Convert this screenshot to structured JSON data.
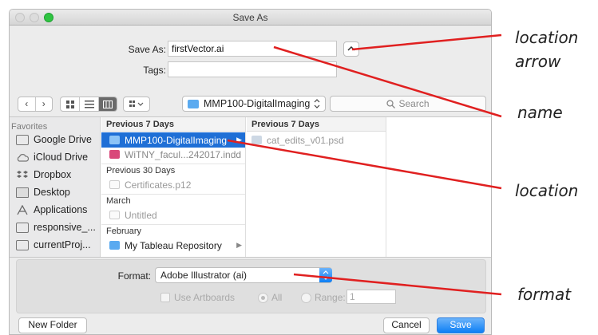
{
  "window": {
    "title": "Save As"
  },
  "form": {
    "save_as_label": "Save As:",
    "save_as_value": "firstVector.ai",
    "tags_label": "Tags:",
    "tags_value": ""
  },
  "toolbar": {
    "location": "MMP100-DigitalImaging",
    "search_placeholder": "Search"
  },
  "sidebar": {
    "heading": "Favorites",
    "items": [
      {
        "label": "Google Drive",
        "icon": "folder-icon"
      },
      {
        "label": "iCloud Drive",
        "icon": "cloud-icon"
      },
      {
        "label": "Dropbox",
        "icon": "dropbox-icon"
      },
      {
        "label": "Desktop",
        "icon": "desktop-icon"
      },
      {
        "label": "Applications",
        "icon": "applications-icon"
      },
      {
        "label": "responsive_...",
        "icon": "folder-icon"
      },
      {
        "label": "currentProj...",
        "icon": "folder-icon"
      }
    ]
  },
  "column1": {
    "header": "Previous 7 Days",
    "rows": [
      {
        "label": "MMP100-DigitalImaging",
        "kind": "folder",
        "selected": true
      },
      {
        "label": "WiTNY_facul...242017.indd",
        "kind": "indd",
        "selected": false
      }
    ],
    "sections": [
      {
        "heading": "Previous 30 Days",
        "rows": [
          {
            "label": "Certificates.p12",
            "kind": "file"
          }
        ]
      },
      {
        "heading": "March",
        "rows": [
          {
            "label": "Untitled",
            "kind": "file"
          }
        ]
      },
      {
        "heading": "February",
        "rows": [
          {
            "label": "My Tableau Repository",
            "kind": "folder"
          }
        ]
      }
    ]
  },
  "column2": {
    "header": "Previous 7 Days",
    "rows": [
      {
        "label": "cat_edits_v01.psd",
        "kind": "psd"
      }
    ]
  },
  "options": {
    "format_label": "Format:",
    "format_value": "Adobe Illustrator (ai)",
    "use_artboards_label": "Use Artboards",
    "all_label": "All",
    "range_label": "Range:",
    "range_value": "1"
  },
  "buttons": {
    "new_folder": "New Folder",
    "cancel": "Cancel",
    "save": "Save"
  },
  "annotations": {
    "location_arrow_line1": "location",
    "location_arrow_line2": "arrow",
    "name": "name",
    "location": "location",
    "format": "format"
  },
  "colors": {
    "selection": "#1f6fd6",
    "primary_button": "#0d7ff5",
    "annotation_line": "#e02020",
    "folder": "#5aaaf0"
  }
}
